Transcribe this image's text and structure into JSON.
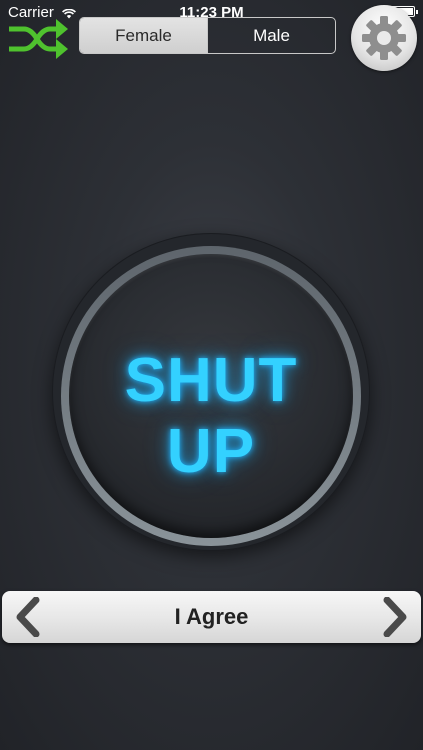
{
  "status_bar": {
    "carrier": "Carrier",
    "time": "11:23 PM",
    "wifi_icon": "wifi-icon",
    "battery_icon": "battery-icon"
  },
  "toolbar": {
    "shuffle_icon": "shuffle-icon",
    "gender_options": [
      "Female",
      "Male"
    ],
    "selected_gender": "Female",
    "settings_icon": "gear-icon"
  },
  "main_button": {
    "line1": "SHUT",
    "line2": "UP"
  },
  "phrase_selector": {
    "prev_icon": "chevron-left-icon",
    "label": "I Agree",
    "next_icon": "chevron-right-icon"
  },
  "colors": {
    "background": "#2d3036",
    "glow_text": "#33d1ff",
    "shuffle_icon": "#4fc22e",
    "gear": "#8e8e8e"
  }
}
